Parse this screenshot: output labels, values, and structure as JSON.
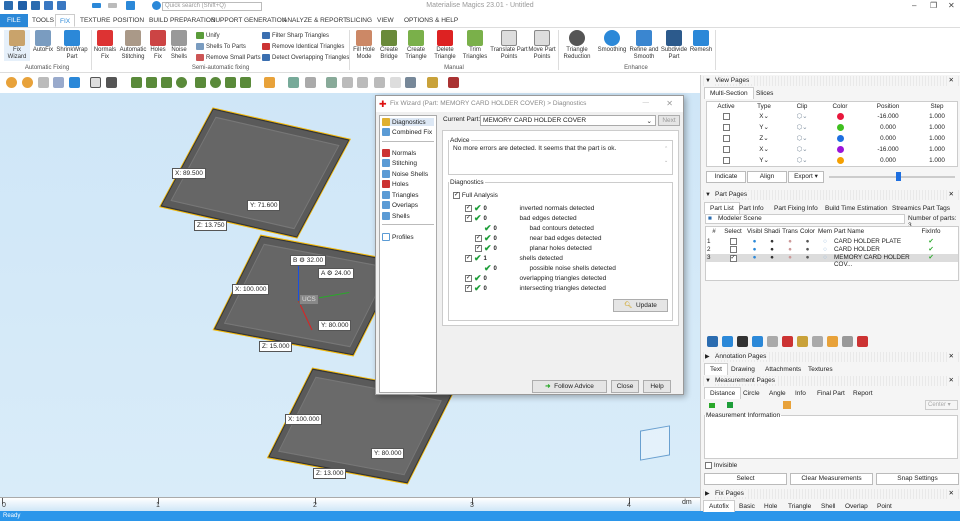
{
  "window": {
    "title": "Materialise Magics 23.01 - Untitled",
    "search_placeholder": "Quick search (Shift+Q)"
  },
  "tabs": [
    "FILE",
    "TOOLS",
    "FIX",
    "TEXTURE",
    "POSITION",
    "BUILD PREPARATION",
    "SUPPORT GENERATION",
    "ANALYZE & REPORT",
    "SLICING",
    "VIEW",
    "OPTIONS & HELP"
  ],
  "ribbon": {
    "automatic": {
      "label": "Automatic Fixing",
      "buttons": [
        "Fix Wizard",
        "AutoFix",
        "ShrinkWrap Part"
      ]
    },
    "semi": {
      "label": "Semi-automatic fixing",
      "buttons": [
        "Normals Fix",
        "Automatic Stitching",
        "Holes Fix",
        "Noise Shells"
      ],
      "small": [
        "Unify",
        "Shells To Parts",
        "Remove Small Parts",
        "Filter Sharp Triangles",
        "Remove Identical Triangles",
        "Detect Overlapping Triangles"
      ]
    },
    "manual": {
      "label": "Manual",
      "buttons": [
        "Fill Hole Mode",
        "Create Bridge",
        "Create Triangle",
        "Delete Triangle",
        "Trim Triangles",
        "Translate Part Points",
        "Move Part Points"
      ]
    },
    "enhance": {
      "label": "Enhance",
      "buttons": [
        "Triangle Reduction",
        "Smoothing",
        "Refine and Smooth",
        "Subdivide Part",
        "Remesh"
      ]
    }
  },
  "viewport": {
    "labels": {
      "p1x": "X: 89.500",
      "p1y": "Y: 71.600",
      "p1z": "Z: 13.750",
      "p2x": "X: 100.000",
      "p2y": "Y: 80.000",
      "p2z": "Z: 15.000",
      "p3x": "X: 100.000",
      "p3y": "Y: 80.000",
      "p3z": "Z: 13.000",
      "dimB": "B",
      "valB": "32.00",
      "dimA": "A",
      "valA": "24.00",
      "ucs": "UCS"
    },
    "ruler": {
      "ticks": [
        "0",
        "1",
        "2",
        "3",
        "4"
      ],
      "unit": "dm"
    }
  },
  "status": "Ready",
  "dialog": {
    "title": "Fix Wizard (Part: MEMORY CARD HOLDER COVER) > Diagnostics",
    "nav": [
      "Diagnostics",
      "Combined Fix",
      "Normals",
      "Stitching",
      "Noise Shells",
      "Holes",
      "Triangles",
      "Overlaps",
      "Shells",
      "Profiles"
    ],
    "current_part_label": "Current Part:",
    "current_part": "MEMORY CARD HOLDER COVER",
    "next": "Next",
    "advice_label": "Advice",
    "advice": "No more errors are detected. It seems that the part is ok.",
    "diagnostics_label": "Diagnostics",
    "full_analysis": "Full Analysis",
    "items": [
      {
        "count": "0",
        "text": "inverted normals detected"
      },
      {
        "count": "0",
        "text": "bad edges detected"
      },
      {
        "count": "0",
        "text": "bad contours detected"
      },
      {
        "count": "0",
        "text": "near bad edges detected"
      },
      {
        "count": "0",
        "text": "planar holes detected"
      },
      {
        "count": "1",
        "text": "shells detected"
      },
      {
        "count": "0",
        "text": "possible noise shells detected"
      },
      {
        "count": "0",
        "text": "overlapping triangles detected"
      },
      {
        "count": "0",
        "text": "intersecting triangles detected"
      }
    ],
    "update": "Update",
    "follow": "Follow Advice",
    "close": "Close",
    "help": "Help"
  },
  "view_pages": {
    "title": "View Pages",
    "tabs": [
      "Multi-Section",
      "Slices"
    ],
    "headers": [
      "Active",
      "Type",
      "Clip",
      "Color",
      "Position",
      "Step"
    ],
    "rows": [
      {
        "type": "X",
        "color": "#e8173c",
        "pos": "-16.000",
        "step": "1.000"
      },
      {
        "type": "Y",
        "color": "#3fbf1f",
        "pos": "0.000",
        "step": "1.000"
      },
      {
        "type": "Z",
        "color": "#1e6fe0",
        "pos": "0.000",
        "step": "1.000"
      },
      {
        "type": "X",
        "color": "#9b13d9",
        "pos": "-16.000",
        "step": "1.000"
      },
      {
        "type": "Y",
        "color": "#f5a000",
        "pos": "0.000",
        "step": "1.000"
      }
    ],
    "buttons": [
      "Indicate",
      "Align",
      "Export"
    ],
    "slider": 0.55
  },
  "part_pages": {
    "title": "Part Pages",
    "tabs": [
      "Part List",
      "Part Info",
      "Part Fixing Info",
      "Build Time Estimation",
      "Streamics Part Tags"
    ],
    "scene": "Modeler Scene",
    "num_label": "Number of parts:",
    "num": "3",
    "headers": [
      "#",
      "Select",
      "Visibl",
      "Shadi",
      "Trans",
      "Color",
      "Mem",
      "Part Name",
      "FixInfo"
    ],
    "rows": [
      {
        "n": "1",
        "name": "CARD HOLDER PLATE",
        "sel": false
      },
      {
        "n": "2",
        "name": "CARD HOLDER",
        "sel": false
      },
      {
        "n": "3",
        "name": "MEMORY CARD HOLDER COV...",
        "sel": true
      }
    ]
  },
  "annotation_pages": {
    "title": "Annotation Pages",
    "tabs": [
      "Text",
      "Drawing",
      "Attachments",
      "Textures"
    ]
  },
  "measurement_pages": {
    "title": "Measurement Pages",
    "tabs": [
      "Distance",
      "Circle",
      "Angle",
      "Info",
      "Final Part",
      "Report"
    ],
    "center": "Center",
    "info_label": "Measurement Information",
    "invisible": "Invisible",
    "buttons": [
      "Select",
      "Clear Measurements",
      "Snap Settings"
    ]
  },
  "fix_pages": {
    "title": "Fix Pages",
    "tabs": [
      "Autofix",
      "Basic",
      "Hole",
      "Triangle",
      "Shell",
      "Overlap",
      "Point"
    ]
  }
}
